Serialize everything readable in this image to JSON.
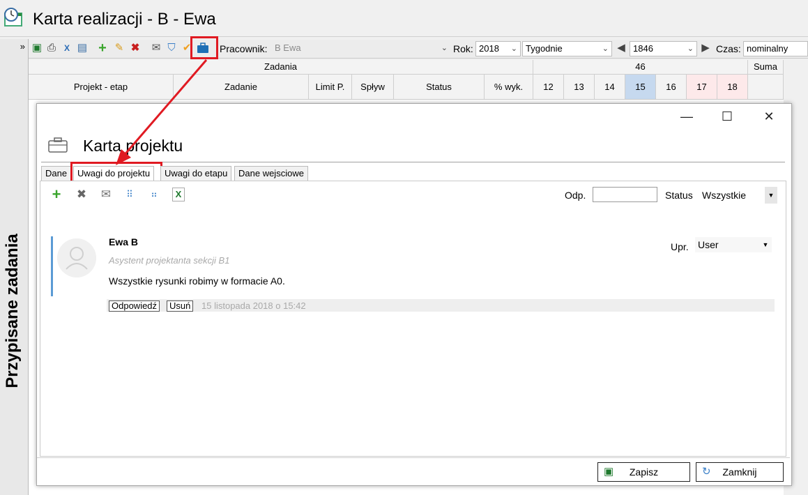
{
  "window": {
    "title": "Karta realizacji - B - Ewa"
  },
  "sidebar": {
    "collapse_glyph": "»",
    "vertical_label": "Przypisane zadania"
  },
  "toolbar": {
    "icons": [
      "save-icon",
      "print-icon",
      "excel-icon",
      "report-icon",
      "add-icon",
      "edit-icon",
      "delete-icon",
      "mail-icon",
      "shield-icon",
      "check-icon",
      "briefcase-icon"
    ],
    "pracownik_label": "Pracownik:",
    "pracownik_value": "B Ewa",
    "rok_label": "Rok:",
    "rok_value": "2018",
    "period_value": "Tygodnie",
    "week_value": "1846",
    "czas_label": "Czas:",
    "czas_value": "nominalny"
  },
  "grid": {
    "group_header_left": "Zadania",
    "group_header_week": "46",
    "group_header_sum": "Suma",
    "columns": [
      "Projekt - etap",
      "Zadanie",
      "Limit P.",
      "Spływ",
      "Status",
      "% wyk."
    ],
    "days": [
      "12",
      "13",
      "14",
      "15",
      "16",
      "17",
      "18"
    ]
  },
  "dialog": {
    "title": "Karta projektu",
    "win_minimize": "—",
    "win_maximize": "☐",
    "win_close": "✕",
    "tabs": [
      "Dane",
      "Uwagi do projektu",
      "Uwagi  do etapu",
      "Dane wejsciowe"
    ],
    "active_tab": "Uwagi do projektu",
    "filters": {
      "odp_label": "Odp.",
      "odp_value": "",
      "status_label": "Status",
      "status_value": "Wszystkie"
    },
    "comment": {
      "author": "Ewa B",
      "role": "Asystent projektanta sekcji B1",
      "text": "Wszystkie rysunki robimy w formacie A0.",
      "reply_label": "Odpowiedź",
      "delete_label": "Usuń",
      "date": "15 listopada 2018 o 15:42",
      "upr_label": "Upr.",
      "upr_value": "User"
    },
    "footer": {
      "save_label": "Zapisz",
      "close_label": "Zamknij"
    }
  },
  "colors": {
    "highlight": "#e01a22",
    "comment_accent": "#5b9bd5",
    "today": "#c6d9ef",
    "weekend": "#fde9ea"
  }
}
